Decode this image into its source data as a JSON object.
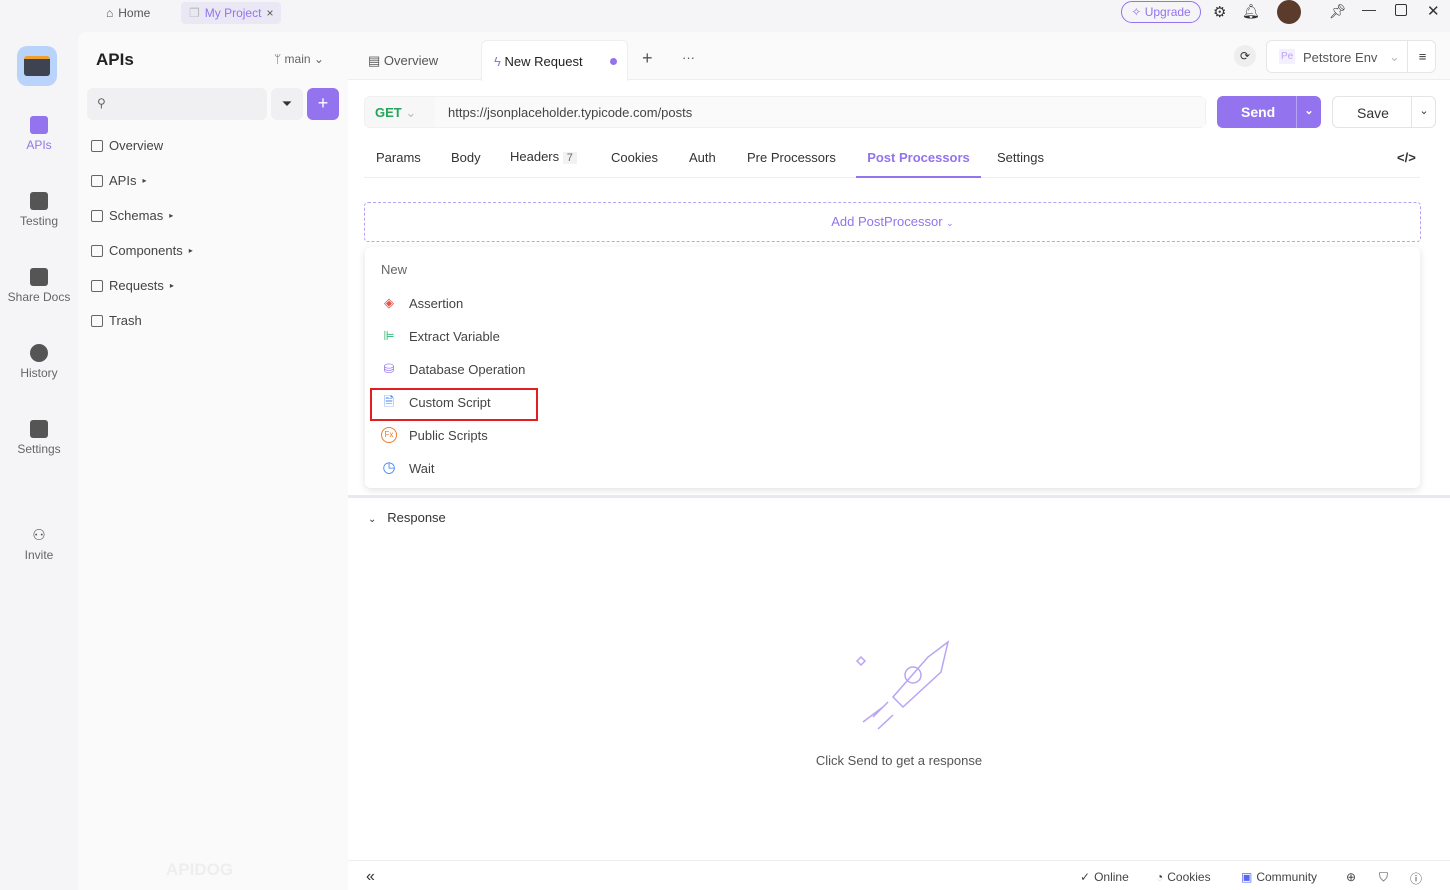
{
  "topbar": {
    "home": "Home",
    "project": "My Project",
    "upgrade": "Upgrade"
  },
  "rail": [
    "APIs",
    "Testing",
    "Share Docs",
    "History",
    "Settings",
    "Invite"
  ],
  "sidebar": {
    "title": "APIs",
    "branch": "main",
    "items": [
      "Overview",
      "APIs",
      "Schemas",
      "Components",
      "Requests",
      "Trash"
    ],
    "watermark": "APIDOG"
  },
  "tabs": {
    "overview": "Overview",
    "active": "New Request"
  },
  "env": {
    "badge": "Pe",
    "name": "Petstore Env"
  },
  "request": {
    "method": "GET",
    "url": "https://jsonplaceholder.typicode.com/posts",
    "send": "Send",
    "save": "Save"
  },
  "subtabs": [
    "Params",
    "Body",
    "Headers",
    "Cookies",
    "Auth",
    "Pre Processors",
    "Post Processors",
    "Settings"
  ],
  "headers_count": "7",
  "add_processor": "Add PostProcessor",
  "menu": {
    "heading": "New",
    "items": [
      "Assertion",
      "Extract Variable",
      "Database Operation",
      "Custom Script",
      "Public Scripts",
      "Wait"
    ]
  },
  "response": {
    "title": "Response",
    "empty": "Click Send to get a response"
  },
  "footer": [
    "Online",
    "Cookies",
    "Community"
  ],
  "colors": {
    "accent": "#9373ee",
    "highlight": "#e02020",
    "get": "#23a55a"
  }
}
